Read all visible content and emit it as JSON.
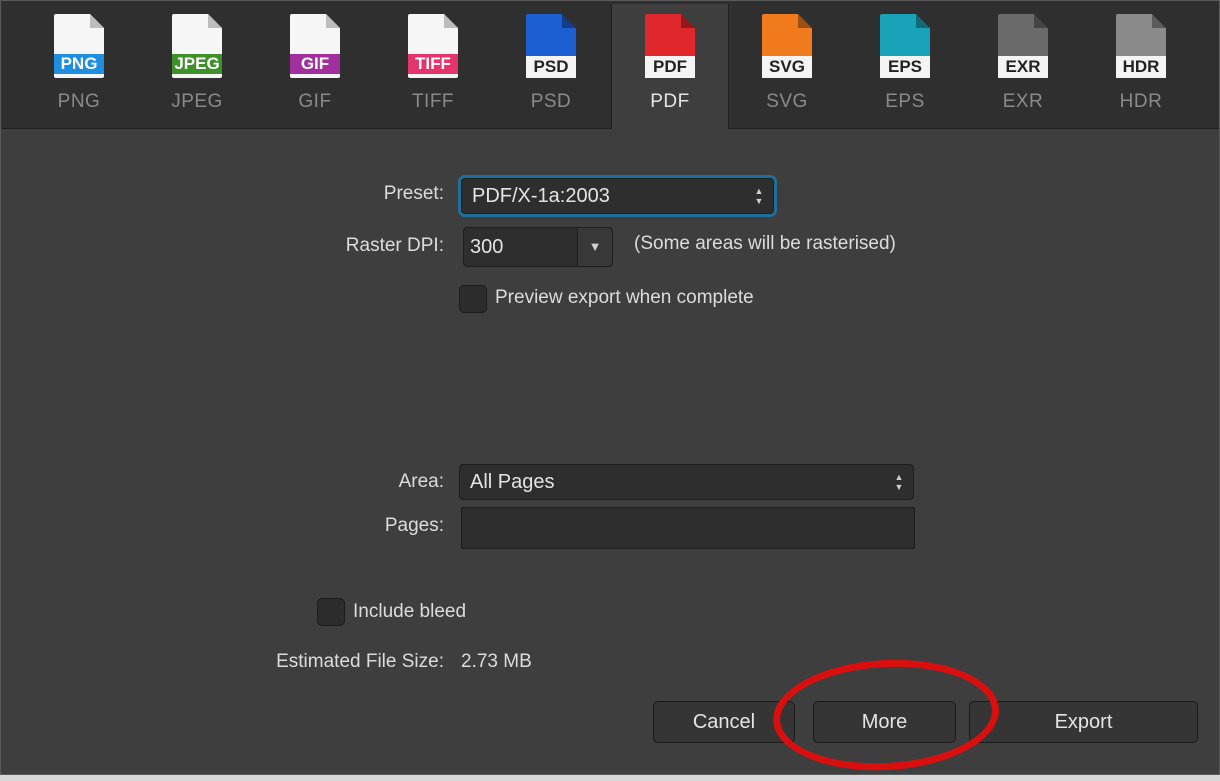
{
  "formats": [
    {
      "label": "PNG",
      "icon": "png-file-icon",
      "color": "#1e8fe0",
      "selected": false
    },
    {
      "label": "JPEG",
      "icon": "jpeg-file-icon",
      "color": "#3f8f2a",
      "selected": false
    },
    {
      "label": "GIF",
      "icon": "gif-file-icon",
      "color": "#a12f9e",
      "selected": false
    },
    {
      "label": "TIFF",
      "icon": "tiff-file-icon",
      "color": "#e3356c",
      "selected": false
    },
    {
      "label": "PSD",
      "icon": "psd-file-icon",
      "color": "#1b5fd3",
      "selected": false
    },
    {
      "label": "PDF",
      "icon": "pdf-file-icon",
      "color": "#e0272b",
      "selected": true
    },
    {
      "label": "SVG",
      "icon": "svg-file-icon",
      "color": "#f07a1c",
      "selected": false
    },
    {
      "label": "EPS",
      "icon": "eps-file-icon",
      "color": "#19a3b8",
      "selected": false
    },
    {
      "label": "EXR",
      "icon": "exr-file-icon",
      "color": "#6a6a6a",
      "selected": false
    },
    {
      "label": "HDR",
      "icon": "hdr-file-icon",
      "color": "#8a8a8a",
      "selected": false
    }
  ],
  "settings": {
    "preset_label": "Preset:",
    "preset_value": "PDF/X-1a:2003",
    "raster_dpi_label": "Raster DPI:",
    "raster_dpi_value": "300",
    "raster_note": "(Some areas will be rasterised)",
    "preview_label": "Preview export when complete",
    "area_label": "Area:",
    "area_value": "All Pages",
    "pages_label": "Pages:",
    "pages_value": "",
    "bleed_label": "Include bleed",
    "filesize_label": "Estimated File Size:",
    "filesize_value": "2.73 MB"
  },
  "buttons": {
    "cancel": "Cancel",
    "more": "More",
    "export": "Export"
  },
  "annotation": {
    "color": "#d90f0f"
  }
}
